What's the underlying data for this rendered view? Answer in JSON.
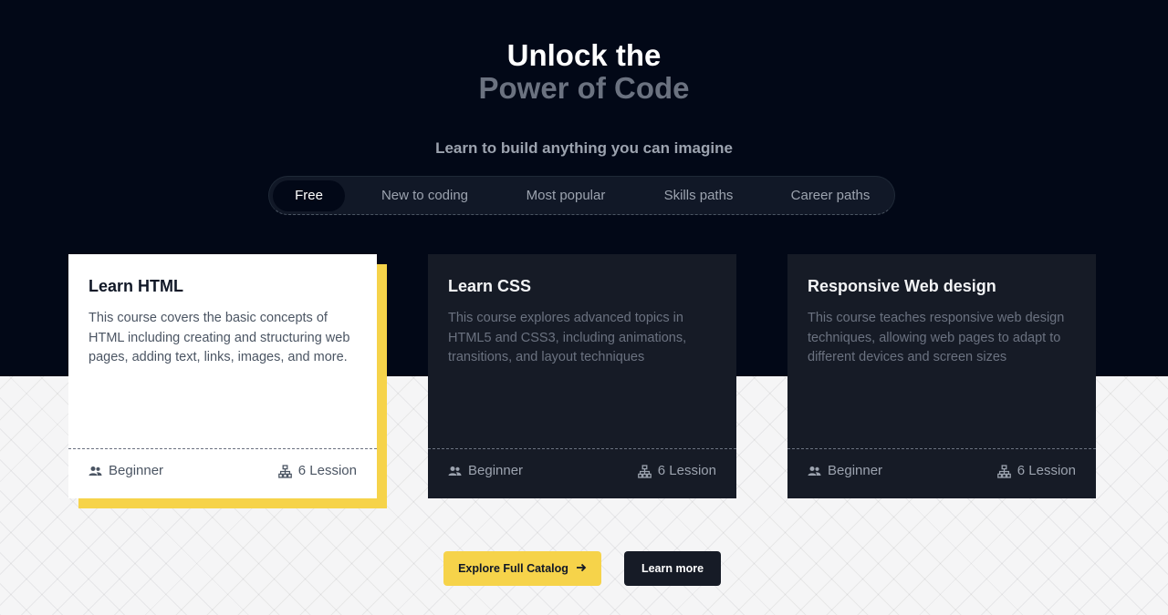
{
  "hero": {
    "title_line1": "Unlock the",
    "title_line2": "Power of Code",
    "subtitle": "Learn to build anything you can imagine"
  },
  "tabs": [
    {
      "label": "Free",
      "active": true
    },
    {
      "label": "New to coding",
      "active": false
    },
    {
      "label": "Most popular",
      "active": false
    },
    {
      "label": "Skills paths",
      "active": false
    },
    {
      "label": "Career paths",
      "active": false
    }
  ],
  "cards": [
    {
      "title": "Learn HTML",
      "description": "This course covers the basic concepts of HTML including creating and structuring web pages, adding text, links, images, and more.",
      "level": "Beginner",
      "lessons": "6 Lession"
    },
    {
      "title": "Learn CSS",
      "description": "This course explores advanced topics in HTML5 and CSS3, including animations, transitions, and layout techniques",
      "level": "Beginner",
      "lessons": "6 Lession"
    },
    {
      "title": "Responsive Web design",
      "description": "This course teaches responsive web design techniques, allowing web pages to adapt to different devices and screen sizes",
      "level": "Beginner",
      "lessons": "6 Lession"
    }
  ],
  "buttons": {
    "explore": "Explore Full Catalog",
    "explore_icon": "arrow-right-icon",
    "learn_more": "Learn more"
  },
  "colors": {
    "hero_bg": "#020817",
    "accent_yellow": "#f6d34a",
    "card_dark": "#161b26"
  }
}
